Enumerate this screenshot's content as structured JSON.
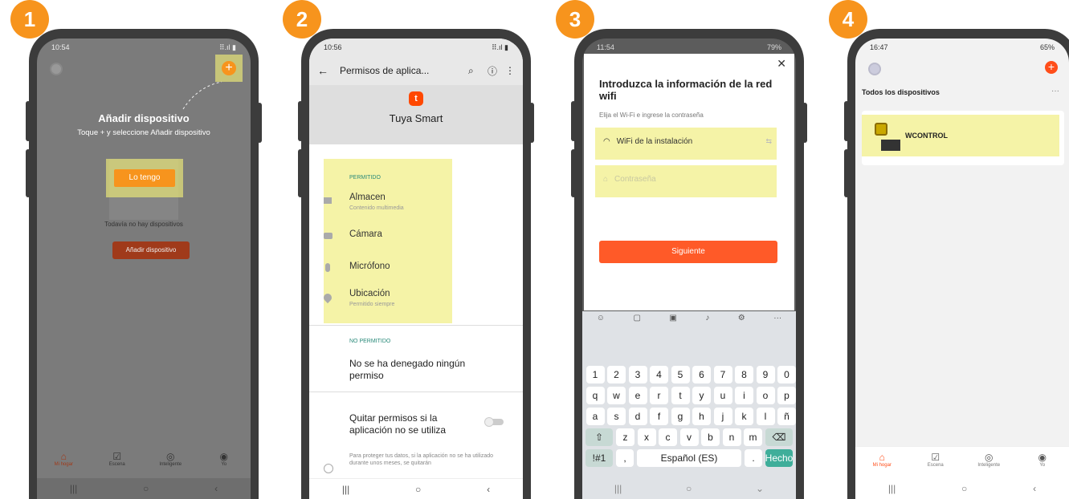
{
  "badges": [
    "1",
    "2",
    "3",
    "4"
  ],
  "s1": {
    "time": "10:54",
    "status_right": "⠿.ıl ▮",
    "title": "Añadir dispositivo",
    "subtitle": "Toque + y seleccione Añadir dispositivo",
    "lo_tengo": "Lo tengo",
    "empty": "Todavía no hay dispositivos",
    "add_btn": "Añadir dispositivo",
    "tabs": [
      "Mi hogar",
      "Escena",
      "Inteligente",
      "Yo"
    ]
  },
  "s2": {
    "time": "10:56",
    "title": "Permisos de aplica...",
    "app_name": "Tuya Smart",
    "allowed_header": "PERMITIDO",
    "allowed": [
      {
        "label": "Almacen",
        "sub": "Contenido multimedia",
        "icon": "folder-icon"
      },
      {
        "label": "Cámara",
        "sub": "",
        "icon": "camera-icon"
      },
      {
        "label": "Micrófono",
        "sub": "",
        "icon": "microphone-icon"
      },
      {
        "label": "Ubicación",
        "sub": "Permitido siempre",
        "icon": "location-icon"
      }
    ],
    "denied_header": "NO PERMITIDO",
    "denied_text": "No se ha denegado ningún permiso",
    "remove_label": "Quitar permisos si la aplicación no se utiliza",
    "footer_text": "Para proteger tus datos, si la aplicación no se ha utilizado durante unos meses, se quitarán"
  },
  "s3": {
    "time": "11:54",
    "battery": "79%",
    "title": "Introduzca la información de la red wifi",
    "subtitle": "Elija el Wi-Fi e ingrese la contraseña",
    "wifi_value": "WiFi de la instalación",
    "password_placeholder": "Contraseña",
    "next": "Siguiente",
    "row1": [
      "1",
      "2",
      "3",
      "4",
      "5",
      "6",
      "7",
      "8",
      "9",
      "0"
    ],
    "row2": [
      "q",
      "w",
      "e",
      "r",
      "t",
      "y",
      "u",
      "i",
      "o",
      "p"
    ],
    "row3": [
      "a",
      "s",
      "d",
      "f",
      "g",
      "h",
      "j",
      "k",
      "l",
      "ñ"
    ],
    "row4": [
      "z",
      "x",
      "c",
      "v",
      "b",
      "n",
      "m"
    ],
    "sym": "!#1",
    "comma": ",",
    "space": "Español (ES)",
    "dot": ".",
    "done": "Hecho"
  },
  "s4": {
    "time": "16:47",
    "battery": "65%",
    "section": "Todos los dispositivos",
    "more": "···",
    "device": "WCONTROL",
    "tabs": [
      "Mi hogar",
      "Escena",
      "Inteligente",
      "Yo"
    ]
  },
  "colors": {
    "accent": "#f7941d",
    "brand_red": "#ff5a28",
    "highlight": "#f0ec78"
  }
}
